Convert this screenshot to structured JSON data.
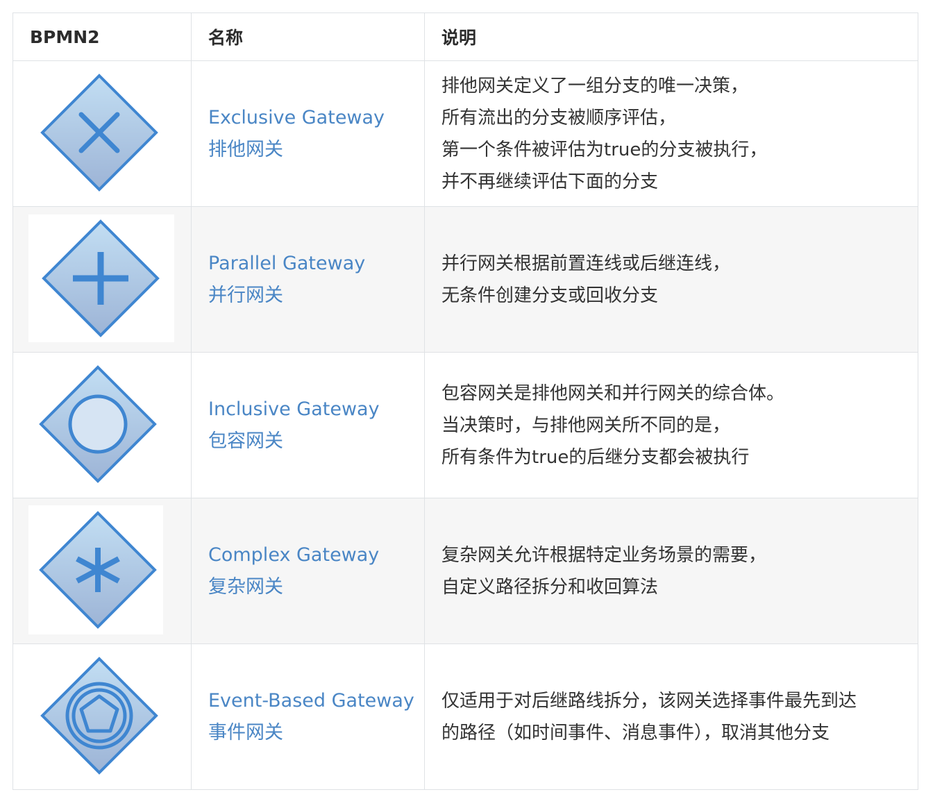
{
  "table": {
    "headers": {
      "col1": "BPMN2",
      "col2": "名称",
      "col3": "说明"
    },
    "rows": [
      {
        "icon": "exclusive-gateway-icon",
        "name_en": "Exclusive Gateway",
        "name_zh": "排他网关",
        "desc": [
          "排他网关定义了一组分支的唯一决策，",
          "所有流出的分支被顺序评估，",
          "第一个条件被评估为true的分支被执行，",
          "并不再继续评估下面的分支"
        ]
      },
      {
        "icon": "parallel-gateway-icon",
        "name_en": "Parallel Gateway",
        "name_zh": "并行网关",
        "desc": [
          "并行网关根据前置连线或后继连线，",
          "无条件创建分支或回收分支"
        ]
      },
      {
        "icon": "inclusive-gateway-icon",
        "name_en": "Inclusive Gateway",
        "name_zh": "包容网关",
        "desc": [
          "包容网关是排他网关和并行网关的综合体。",
          "当决策时，与排他网关所不同的是，",
          "所有条件为true的后继分支都会被执行"
        ]
      },
      {
        "icon": "complex-gateway-icon",
        "name_en": "Complex Gateway",
        "name_zh": "复杂网关",
        "desc": [
          "复杂网关允许根据特定业务场景的需要，",
          "自定义路径拆分和收回算法"
        ]
      },
      {
        "icon": "event-based-gateway-icon",
        "name_en": "Event-Based Gateway",
        "name_zh": "事件网关",
        "desc": [
          "仅适用于对后继路线拆分，该网关选择事件最先到达",
          "的路径（如时间事件、消息事件），取消其他分支"
        ]
      }
    ]
  },
  "colors": {
    "link": "#4a86c5",
    "border": "#dfe2e5",
    "alt_row": "#f6f6f6",
    "icon_stroke": "#3f86d1",
    "icon_fill_top": "#bfdcf2",
    "icon_fill_bottom": "#9fb8d8"
  }
}
